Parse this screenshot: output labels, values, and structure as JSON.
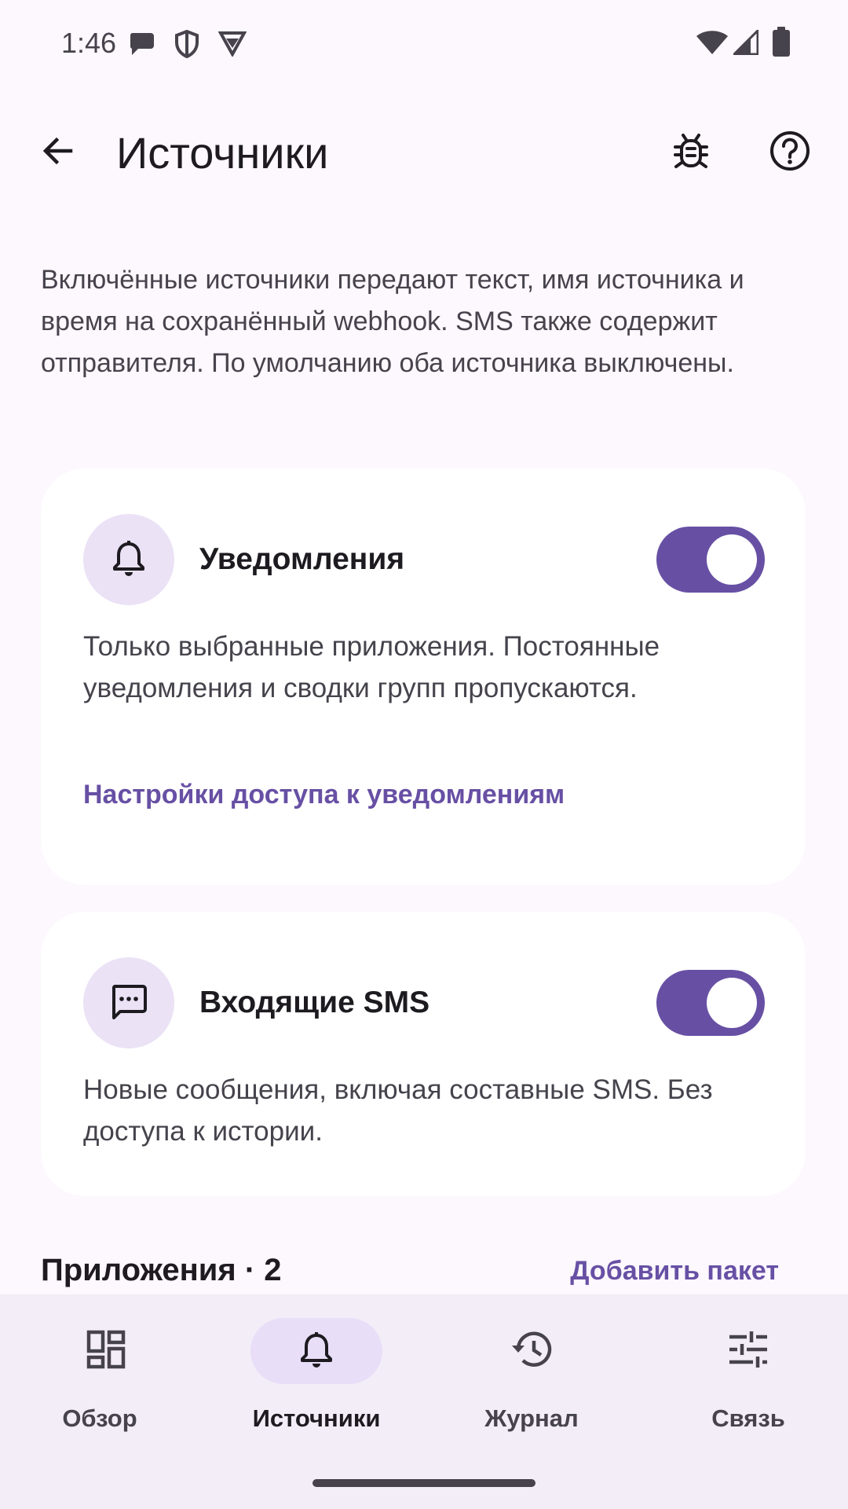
{
  "status_bar": {
    "time": "1:46",
    "left_icons": [
      "chat-bubble-icon",
      "shield-icon",
      "vpn-icon"
    ],
    "right_icons": [
      "wifi-icon",
      "signal-icon",
      "battery-icon"
    ]
  },
  "top_bar": {
    "title": "Источники",
    "back_icon": "arrow-back-icon",
    "action_icons": [
      "bug-icon",
      "help-icon"
    ]
  },
  "intro_text": "Включённые источники передают текст, имя источника и время на сохранённый webhook. SMS также содержит отправителя. По умолчанию оба источника выключены.",
  "cards": {
    "notifications": {
      "icon": "bell-icon",
      "title": "Уведомления",
      "enabled": true,
      "description": "Только выбранные приложения. Постоянные уведомления и сводки групп пропускаются.",
      "link": "Настройки доступа к уведомлениям"
    },
    "sms": {
      "icon": "sms-icon",
      "title": "Входящие SMS",
      "enabled": true,
      "description": "Новые сообщения, включая составные SMS. Без доступа к истории."
    }
  },
  "apps_section": {
    "title": "Приложения · 2",
    "action": "Добавить пакет"
  },
  "bottom_nav": {
    "items": [
      {
        "label": "Обзор",
        "icon": "dashboard-icon",
        "active": false
      },
      {
        "label": "Источники",
        "icon": "bell-icon",
        "active": true
      },
      {
        "label": "Журнал",
        "icon": "history-icon",
        "active": false
      },
      {
        "label": "Связь",
        "icon": "tune-icon",
        "active": false
      }
    ]
  },
  "colors": {
    "background": "#fdf7fe",
    "accent": "#6750a4",
    "icon_container": "#ebe2f6",
    "nav_background": "#f3edf7",
    "nav_indicator": "#e8def8"
  }
}
